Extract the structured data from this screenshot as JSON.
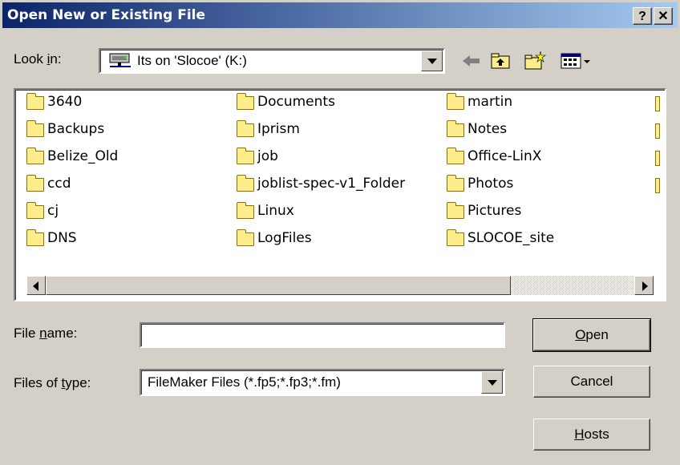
{
  "window": {
    "title": "Open New or Existing File",
    "help_label": "?",
    "close_label": "✕"
  },
  "look_in": {
    "label_prefix": "Look ",
    "label_underlined": "i",
    "label_suffix": "n:",
    "value": "Its on 'Slocoe' (K:)",
    "icon": "network-drive-icon"
  },
  "toolbar": {
    "icons": [
      "back-arrow-icon",
      "up-folder-icon",
      "new-folder-icon",
      "view-menu-icon"
    ]
  },
  "files": {
    "columns": [
      [
        "3640",
        "Backups",
        "Belize_Old",
        "ccd",
        "cj",
        "DNS"
      ],
      [
        "Documents",
        "Iprism",
        "job",
        "joblist-spec-v1_Folder",
        "Linux",
        "LogFiles"
      ],
      [
        "martin",
        "Notes",
        "Office-LinX",
        "Photos",
        "Pictures",
        "SLOCOE_site"
      ]
    ]
  },
  "file_name": {
    "label_prefix": "File ",
    "label_underlined": "n",
    "label_suffix": "ame:",
    "value": ""
  },
  "file_type": {
    "label_prefix": "Files of ",
    "label_underlined": "t",
    "label_suffix": "ype:",
    "value": "FileMaker Files (*.fp5;*.fp3;*.fm)"
  },
  "buttons": {
    "open_underlined": "O",
    "open_rest": "pen",
    "cancel": "Cancel",
    "hosts_underlined": "H",
    "hosts_rest": "osts"
  },
  "colors": {
    "title_start": "#0a246a",
    "title_end": "#a6caf0",
    "face": "#d4d0c8",
    "folder": "#ffec8b"
  }
}
